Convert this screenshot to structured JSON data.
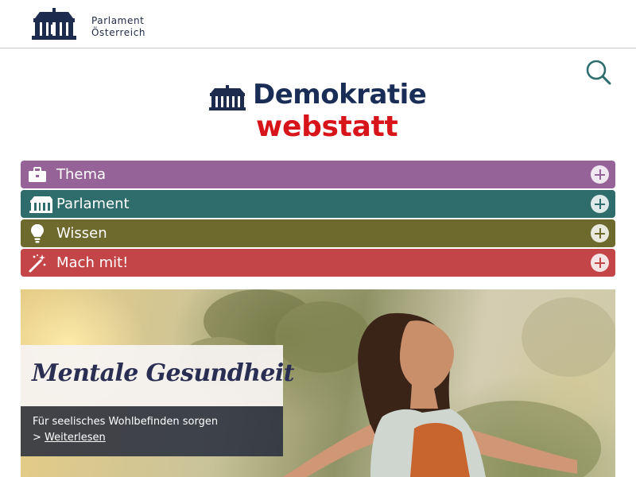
{
  "header": {
    "org_line1": "Parlament",
    "org_line2": "Österreich"
  },
  "brand": {
    "title": "Demokratie",
    "subtitle": "webstatt"
  },
  "search": {
    "icon": "search-icon",
    "color": "#2f6e6e"
  },
  "nav": {
    "items": [
      {
        "label": "Thema",
        "icon": "briefcase-icon",
        "color": "#966398"
      },
      {
        "label": "Parlament",
        "icon": "parliament-icon",
        "color": "#2f6d6c"
      },
      {
        "label": "Wissen",
        "icon": "lightbulb-icon",
        "color": "#6e6a2e"
      },
      {
        "label": "Mach mit!",
        "icon": "magic-wand-icon",
        "color": "#c44547"
      }
    ]
  },
  "hero": {
    "title": "Mentale Gesundheit",
    "description": "Für seelisches Wohlbefinden sorgen",
    "link_prefix": "> ",
    "link_label": "Weiterlesen"
  }
}
